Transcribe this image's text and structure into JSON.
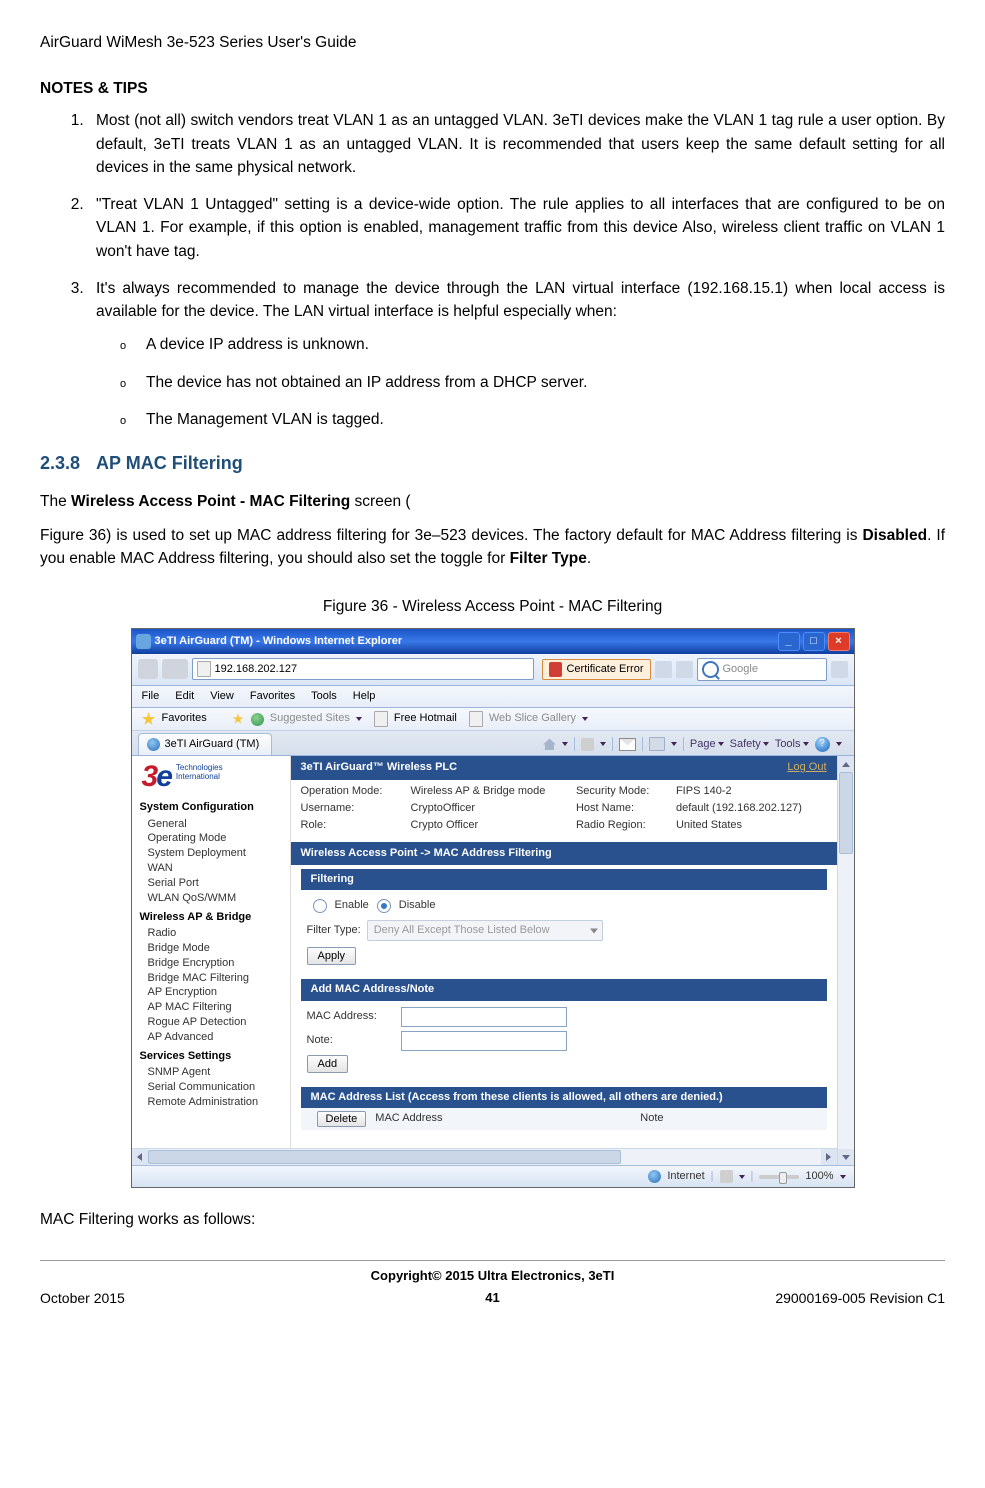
{
  "doc": {
    "header": "AirGuard WiMesh 3e-523 Series User's Guide",
    "notes_tips": "NOTES & TIPS",
    "notes": [
      "Most (not all) switch vendors treat VLAN 1 as an untagged VLAN. 3eTI devices make the VLAN 1 tag rule a user option. By default, 3eTI treats VLAN 1 as an untagged VLAN. It is recommended that users keep the same default setting for all devices in the same physical network.",
      "\"Treat VLAN 1 Untagged\" setting is a device-wide option. The rule applies to all interfaces that are configured to be on VLAN 1.   For example, if this option is enabled, management traffic from this device Also, wireless client traffic on VLAN 1 won't have tag.",
      "It's always recommended to manage the device through the LAN virtual interface (192.168.15.1) when local access is available for the device. The LAN virtual interface is helpful especially when:"
    ],
    "sub_items": [
      "A device IP address is unknown.",
      "The device has not obtained an IP address from a DHCP server.",
      "The Management VLAN is tagged."
    ],
    "section_num": "2.3.8",
    "section_title": "AP MAC Filtering",
    "para1_pre": "The ",
    "para1_bold": "Wireless Access Point - MAC Filtering",
    "para1_post": " screen (",
    "para2_pre": "Figure 36) is used to set up MAC address filtering for 3e–523 devices. The factory default for MAC Address filtering is ",
    "para2_bold1": "Disabled",
    "para2_mid": ". If you enable MAC Address filtering, you should also set the toggle for ",
    "para2_bold2": "Filter Type",
    "para2_post": ".",
    "figure_caption": "Figure 36 - Wireless Access Point - MAC Filtering",
    "para3": "MAC Filtering works as follows:",
    "copyright": "Copyright© 2015 Ultra Electronics, 3eTI",
    "footer_left": "October 2015",
    "footer_center": "41",
    "footer_right": "29000169-005 Revision C1"
  },
  "win": {
    "title": "3eTI AirGuard (TM) - Windows Internet Explorer",
    "address": "192.168.202.127",
    "cert": "Certificate Error",
    "search_ph": "Google",
    "menu": {
      "file": "File",
      "edit": "Edit",
      "view": "View",
      "favorites": "Favorites",
      "tools": "Tools",
      "help": "Help"
    },
    "fav_label": "Favorites",
    "suggested": "Suggested Sites",
    "free_hotmail": "Free Hotmail",
    "webslice": "Web Slice Gallery",
    "tab": "3eTI AirGuard (TM)",
    "toolbar": {
      "page": "Page",
      "safety": "Safety",
      "tools": "Tools"
    },
    "status_internet": "Internet",
    "zoom": "100%"
  },
  "app": {
    "logo_tech": "Technologies\nInternational",
    "side_groups": [
      {
        "title": "System Configuration",
        "items": [
          "General",
          "Operating Mode",
          "System Deployment",
          "WAN",
          "Serial Port",
          "WLAN QoS/WMM"
        ]
      },
      {
        "title": "Wireless AP & Bridge",
        "items": [
          "Radio",
          "Bridge Mode",
          "Bridge Encryption",
          "Bridge MAC Filtering",
          "AP Encryption",
          "AP MAC Filtering",
          "Rogue AP Detection",
          "AP Advanced"
        ]
      },
      {
        "title": "Services Settings",
        "items": [
          "SNMP Agent",
          "Serial Communication",
          "Remote Administration"
        ]
      }
    ],
    "banner": "3eTI AirGuard™ Wireless PLC",
    "logout": "Log Out",
    "info": {
      "op_mode_l": "Operation Mode:",
      "op_mode_v": "Wireless AP & Bridge mode",
      "sec_mode_l": "Security Mode:",
      "sec_mode_v": "FIPS 140-2",
      "user_l": "Username:",
      "user_v": "CryptoOfficer",
      "host_l": "Host Name:",
      "host_v": "default (192.168.202.127)",
      "role_l": "Role:",
      "role_v": "Crypto Officer",
      "region_l": "Radio Region:",
      "region_v": "United States"
    },
    "crumb": "Wireless Access Point -> MAC Address Filtering",
    "filtering_bar": "Filtering",
    "enable": "Enable",
    "disable": "Disable",
    "filter_type_l": "Filter Type:",
    "filter_type_v": "Deny All Except Those Listed Below",
    "apply": "Apply",
    "add_bar": "Add MAC Address/Note",
    "mac_l": "MAC Address:",
    "note_l": "Note:",
    "add": "Add",
    "list_bar": "MAC Address List (Access from these clients is allowed, all others are denied.)",
    "del": "Delete",
    "col_mac": "MAC Address",
    "col_note": "Note"
  }
}
